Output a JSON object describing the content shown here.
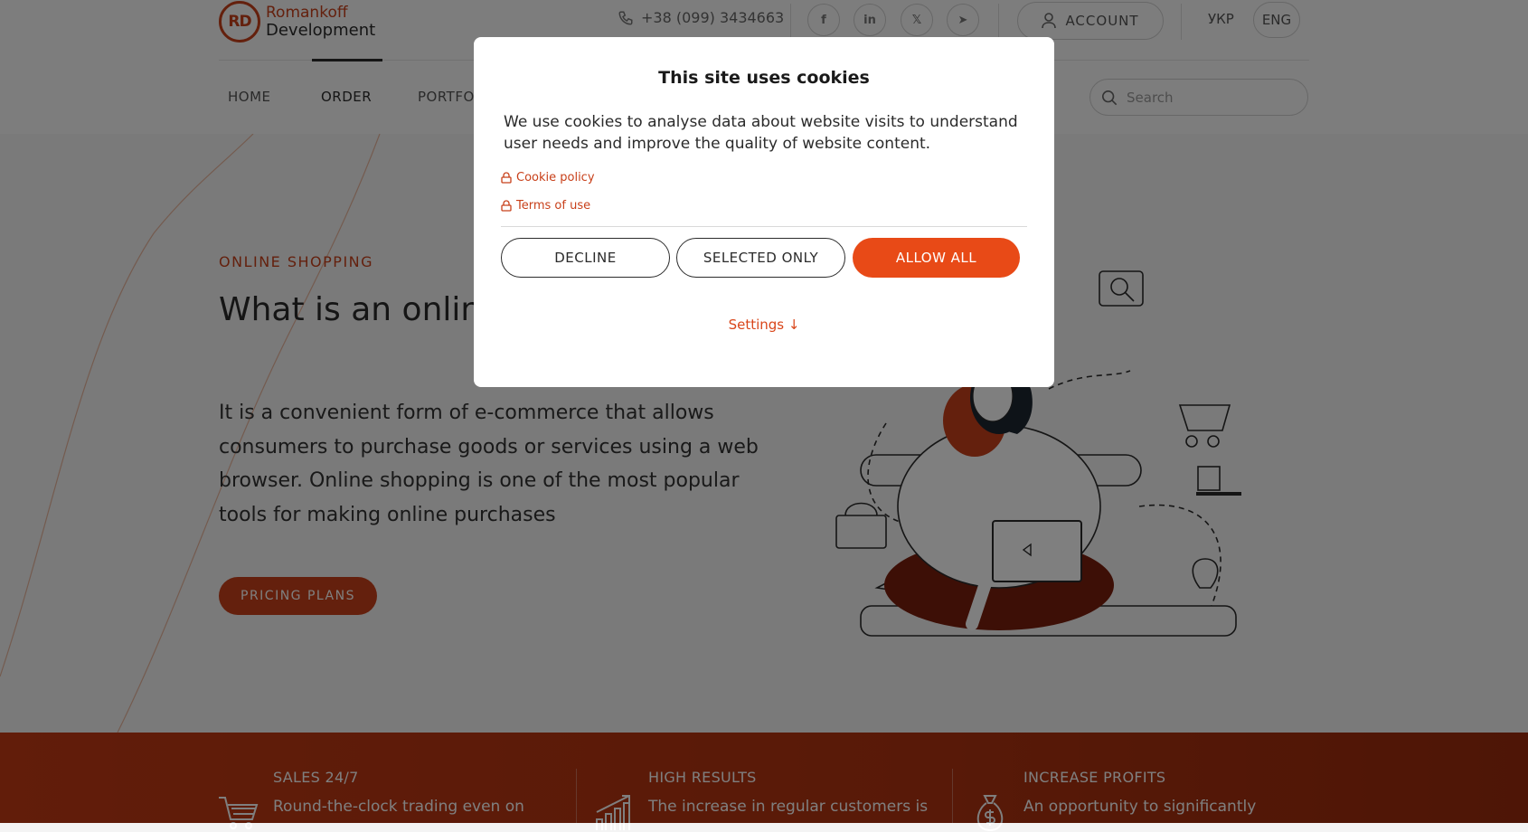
{
  "logo": {
    "mark": "RD",
    "line1": "Romankoff",
    "line2": "Development"
  },
  "header": {
    "phone": "+38 (099) 3434663",
    "account_label": "ACCOUNT",
    "lang_ukr": "УКР",
    "lang_eng": "ENG",
    "social": [
      "facebook-icon",
      "linkedin-icon",
      "x-icon",
      "telegram-icon"
    ]
  },
  "nav": {
    "items": [
      {
        "label": "HOME"
      },
      {
        "label": "ORDER"
      },
      {
        "label": "PORTFO"
      }
    ],
    "active": "ORDER"
  },
  "search": {
    "placeholder": "Search"
  },
  "hero": {
    "kicker": "ONLINE SHOPPING",
    "title": "What is an onlin",
    "text": "It is a convenient form of e-commerce that allows consumers to purchase goods or services using a web browser. Online shopping is one of the most popular tools for making online purchases",
    "cta": "PRICING PLANS"
  },
  "features": [
    {
      "title": "SALES 24/7",
      "text": "Round-the-clock trading even on",
      "icon": "shopping-cart-icon"
    },
    {
      "title": "HIGH RESULTS",
      "text": "The increase in regular customers is",
      "icon": "growth-chart-icon"
    },
    {
      "title": "INCREASE PROFITS",
      "text": "An opportunity to significantly",
      "icon": "money-bag-icon"
    }
  ],
  "cookie_modal": {
    "title": "This site uses cookies",
    "text": "We use cookies to analyse data about website visits to understand user needs and improve the quality of website content.",
    "cookie_policy": "Cookie policy",
    "terms": "Terms of use",
    "decline": "DECLINE",
    "selected_only": "SELECTED ONLY",
    "allow_all": "ALLOW ALL",
    "settings": "Settings ↓"
  },
  "colors": {
    "accent": "#c8401a",
    "allow_button": "#e84a17",
    "band": "#b13310"
  }
}
